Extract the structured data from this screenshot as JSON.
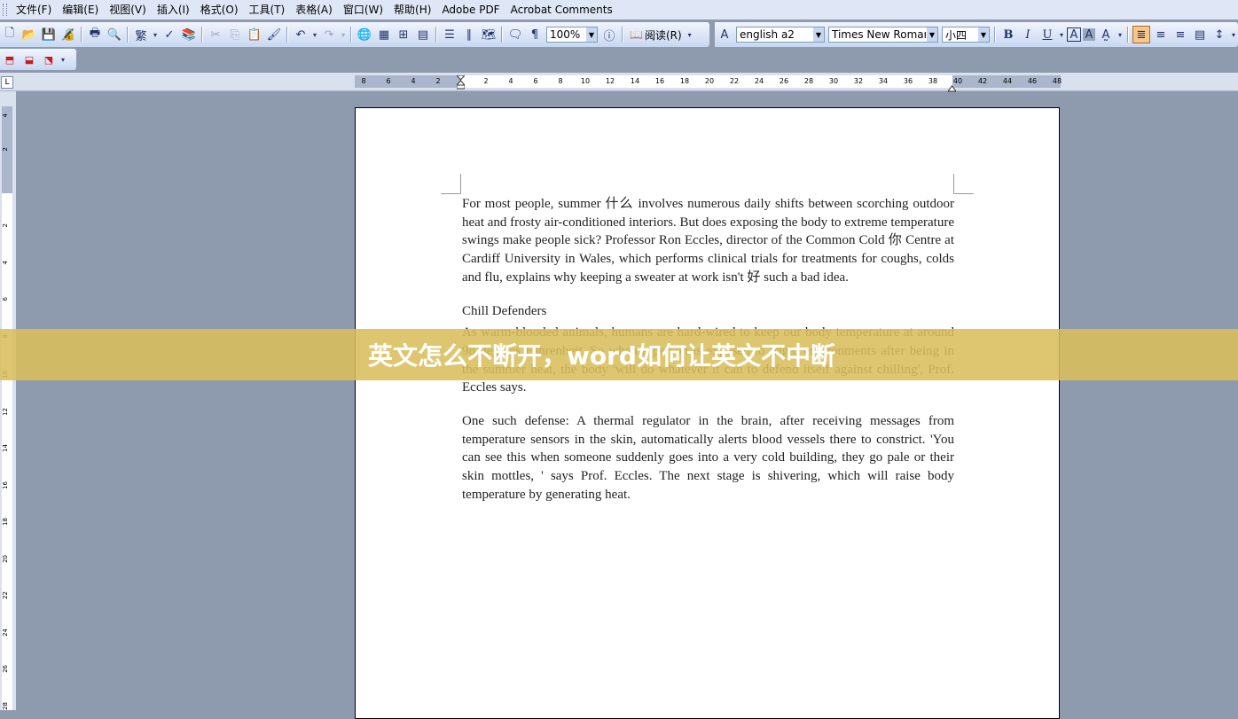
{
  "menu": [
    "文件(F)",
    "编辑(E)",
    "视图(V)",
    "插入(I)",
    "格式(O)",
    "工具(T)",
    "表格(A)",
    "窗口(W)",
    "帮助(H)",
    "Adobe PDF",
    "Acrobat Comments"
  ],
  "toolbar": {
    "zoom": "100%",
    "reading_mode": "阅读(R)",
    "trad_simplified": "繁",
    "style": "english a2",
    "font": "Times New Roman",
    "font_size": "小四",
    "bold": "B",
    "italic": "I",
    "underline": "U"
  },
  "ruler": {
    "h_left": [
      "8",
      "6",
      "4",
      "2"
    ],
    "h_right": [
      "2",
      "4",
      "6",
      "8",
      "10",
      "12",
      "14",
      "16",
      "18",
      "20",
      "22",
      "24",
      "26",
      "28",
      "30",
      "32",
      "34",
      "36",
      "38",
      "40",
      "42",
      "44",
      "46",
      "48"
    ],
    "v_top": [
      "4",
      "2"
    ],
    "v_main": [
      "2",
      "4",
      "6",
      "8",
      "10",
      "12",
      "14",
      "16",
      "18",
      "20",
      "22",
      "24",
      "26",
      "28"
    ]
  },
  "document": {
    "p1": "For most people, summer 什么 involves numerous daily shifts between scorching outdoor heat and frosty air-conditioned interiors. But does exposing the body to extreme temperature swings make people sick? Professor Ron Eccles, director of the Common Cold 你 Centre at Cardiff University in Wales, which performs clinical trials for treatments for coughs, colds and flu, explains why keeping a sweater at work isn't 好 such a bad idea.",
    "heading": "Chill Defenders",
    "p2": "As warm-blooded animals, humans are hard-wired to keep our body temperature at around 98 degrees Fahrenheit. So when a person is exposed to frigid environments after being in the summer heat, the body 'will do whatever it can to defend itself against chilling', Prof. Eccles says.",
    "p3": "One such defense: A thermal regulator in the brain, after receiving messages from temperature sensors in the skin, automatically alerts blood vessels there to constrict. 'You can see this when someone suddenly goes into a very cold building, they go pale or their skin mottles, ' says Prof. Eccles. The next stage is shivering, which will raise body temperature by generating heat."
  },
  "banner": {
    "text": "英文怎么不断开，word如何让英文不中断"
  },
  "colors": {
    "workspace": "#8e9bae",
    "banner": "#dabe5c"
  }
}
